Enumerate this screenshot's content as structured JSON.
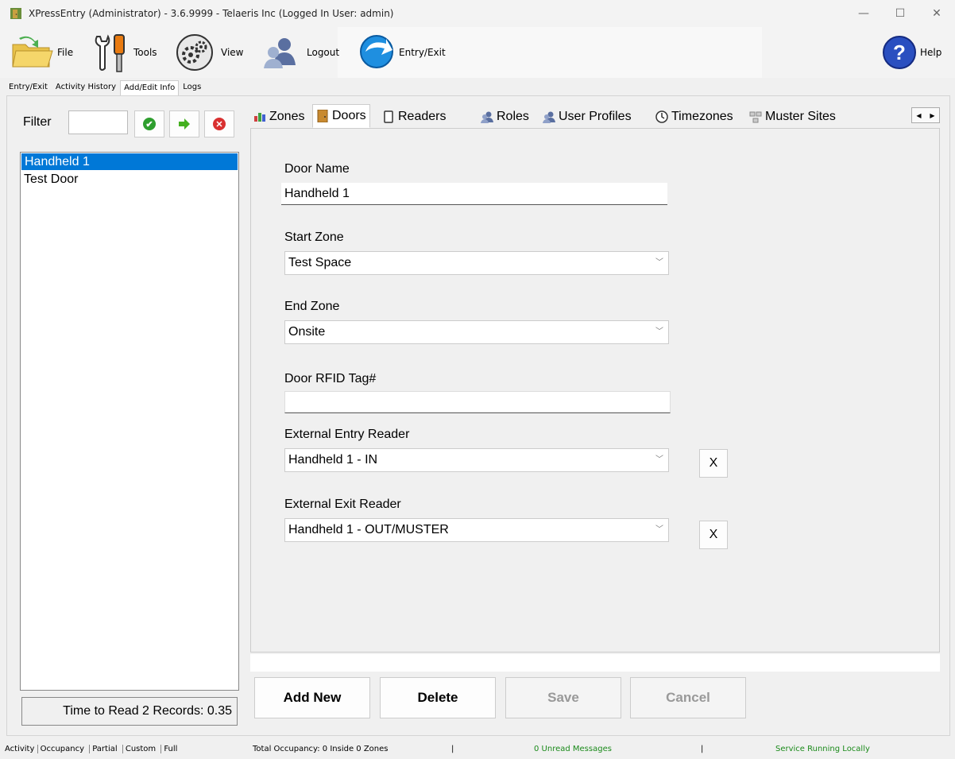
{
  "window": {
    "title": "XPressEntry (Administrator)  - 3.6.9999 - Telaeris Inc (Logged In User: admin)",
    "minimize": "—",
    "maximize": "☐",
    "close": "✕"
  },
  "toolbar": {
    "file": "File",
    "tools": "Tools",
    "view": "View",
    "logout": "Logout",
    "entry_exit": "Entry/Exit",
    "help": "Help"
  },
  "top_tabs": [
    "Entry/Exit",
    "Activity History",
    "Add/Edit Info",
    "Logs"
  ],
  "left": {
    "filter_label": "Filter",
    "filter_value": "",
    "items": [
      "Handheld 1",
      "Test Door"
    ],
    "time_status": "Time to Read 2 Records: 0.35"
  },
  "tabs": [
    "Zones",
    "Doors",
    "Readers",
    "Roles",
    "User Profiles",
    "Timezones",
    "Muster Sites"
  ],
  "form": {
    "door_name_label": "Door Name",
    "door_name_value": "Handheld 1",
    "start_zone_label": "Start Zone",
    "start_zone_value": "Test Space",
    "end_zone_label": "End Zone",
    "end_zone_value": "Onsite",
    "rfid_label": "Door RFID Tag#",
    "rfid_value": "",
    "entry_reader_label": "External Entry Reader",
    "entry_reader_value": "Handheld 1 - IN",
    "exit_reader_label": "External Exit Reader",
    "exit_reader_value": "Handheld 1 - OUT/MUSTER",
    "clear_label": "X"
  },
  "actions": {
    "add_new": "Add New",
    "delete": "Delete",
    "save": "Save",
    "cancel": "Cancel"
  },
  "status": {
    "links": [
      "Activity",
      "Occupancy",
      "Partial",
      "Custom",
      "Full"
    ],
    "occupancy": "Total Occupancy: 0 Inside 0 Zones",
    "messages": "0 Unread Messages",
    "service": "Service Running Locally"
  },
  "colors": {
    "selection": "#0078d7",
    "accept": "#2e9e2e",
    "go": "#44b020",
    "clear": "#d93030",
    "status_green": "#1a8a1a"
  }
}
